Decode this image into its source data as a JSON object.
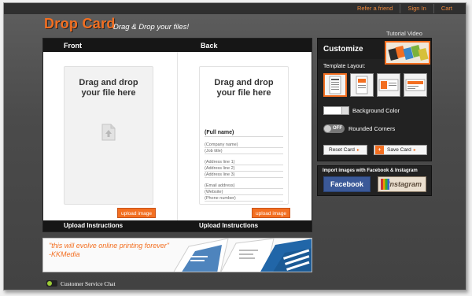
{
  "header": {
    "links": [
      "Refer a friend",
      "Sign In",
      "Cart"
    ],
    "logo": "Drop Card",
    "tagline": "Drag & Drop your files!",
    "tutorial_link": "Tutorial Video"
  },
  "card": {
    "front_label": "Front",
    "back_label": "Back",
    "drop_text_line1": "Drag and drop",
    "drop_text_line2": "your file here",
    "upload_button": "upload image",
    "upload_instructions": "Upload Instructions",
    "back_fields": {
      "full_name": "(Full name)",
      "company": "(Company name)",
      "job_title": "(Job title)",
      "address1": "(Address line 1)",
      "address2": "(Address line 2)",
      "address3": "(Address line 3)",
      "email": "(Email address)",
      "website": "(Website)",
      "phone": "(Phone number)"
    }
  },
  "promo": {
    "quote": "\"this will evolve online printing forever\"",
    "author": "-KKMedia"
  },
  "chat": {
    "label": "Customer Service Chat"
  },
  "customize": {
    "title": "Customize",
    "template_label": "Template Layout:",
    "background_color_label": "Background Color",
    "rounded_corners_label": "Rounded Corners",
    "toggle_state": "OFF",
    "reset_button": "Reset Card",
    "save_button": "Save Card"
  },
  "import": {
    "title": "Import images with Facebook & Instagram",
    "facebook": "Facebook",
    "instagram": "Instagram"
  },
  "colors": {
    "accent": "#f36f21",
    "facebook": "#3b5998",
    "panel": "#222222"
  }
}
